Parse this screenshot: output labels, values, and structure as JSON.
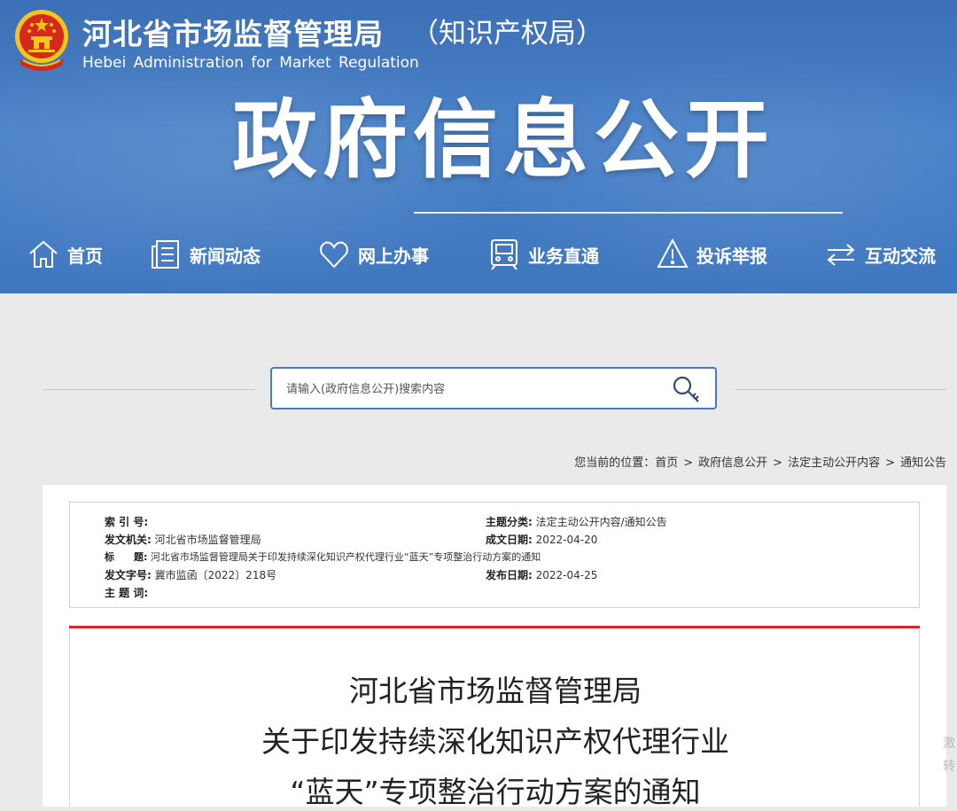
{
  "header": {
    "org_name_cn": "河北省市场监督管理局",
    "org_name_cn_suffix": "（知识产权局）",
    "org_name_en": "Hebei Administration for Market Regulation",
    "section_title": "政府信息公开"
  },
  "nav": [
    {
      "label": "首页",
      "icon": "home-icon"
    },
    {
      "label": "新闻动态",
      "icon": "news-icon"
    },
    {
      "label": "网上办事",
      "icon": "heart-icon"
    },
    {
      "label": "业务直通",
      "icon": "train-icon"
    },
    {
      "label": "投诉举报",
      "icon": "warning-icon"
    },
    {
      "label": "互动交流",
      "icon": "exchange-icon"
    }
  ],
  "search": {
    "placeholder": "请输入(政府信息公开)搜索内容",
    "icon": "search-icon"
  },
  "breadcrumb": {
    "prefix": "您当前的位置：",
    "items": [
      "首页",
      "政府信息公开",
      "法定主动公开内容",
      "通知公告"
    ],
    "separator": ">"
  },
  "meta": {
    "index_label": "索 引 号:",
    "index_value": "",
    "topic_label": "主题分类:",
    "topic_value": "法定主动公开内容/通知公告",
    "issuer_label": "发文机关:",
    "issuer_value": "河北省市场监督管理局",
    "created_label": "成文日期:",
    "created_value": "2022-04-20",
    "title_label": "标　　题:",
    "title_value": "河北省市场监督管理局关于印发持续深化知识产权代理行业“蓝天”专项整治行动方案的通知",
    "docno_label": "发文字号:",
    "docno_value": "冀市监函〔2022〕218号",
    "published_label": "发布日期:",
    "published_value": "2022-04-25",
    "keywords_label": "主 题 词:",
    "keywords_value": ""
  },
  "document": {
    "title_lines": [
      "河北省市场监督管理局",
      "关于印发持续深化知识产权代理行业",
      "“蓝天”专项整治行动方案的通知"
    ]
  },
  "edge_text": "激转",
  "colors": {
    "header_blue": "#3e76bf",
    "search_border": "#4a79bd",
    "red_rule": "#d7252a",
    "emblem_red": "#d42a1e",
    "emblem_gold": "#f5c518"
  }
}
